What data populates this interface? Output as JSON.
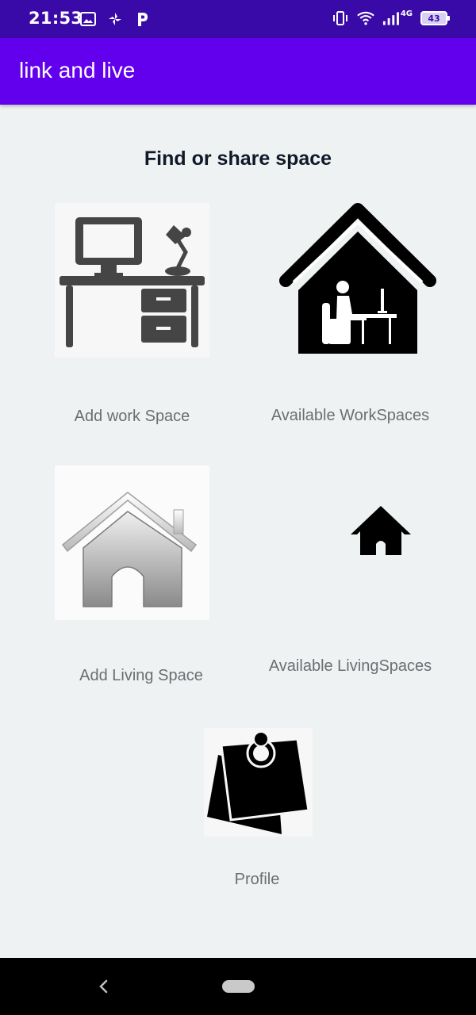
{
  "status_bar": {
    "time": "21:53",
    "left_icons": [
      "gallery-icon",
      "pinwheel-icon",
      "parking-p-icon"
    ],
    "right_icons": [
      "vibrate-icon",
      "wifi-icon",
      "signal-icon",
      "battery-icon"
    ],
    "network_label": "4G",
    "battery_level": "43"
  },
  "app_bar": {
    "title": "link and live"
  },
  "main": {
    "heading": "Find or share space",
    "tiles": [
      {
        "label": "Add work Space",
        "icon": "desk-workspace-icon"
      },
      {
        "label": "Available WorkSpaces",
        "icon": "house-with-worker-icon"
      },
      {
        "label": "Add Living Space",
        "icon": "house-icon"
      },
      {
        "label": "Available LivingSpaces",
        "icon": "small-house-icon"
      },
      {
        "label": "Profile",
        "icon": "pinned-notes-icon"
      }
    ]
  },
  "nav_bar": {
    "icons": [
      "back-icon",
      "home-pill-icon"
    ]
  },
  "colors": {
    "status_bar": "#3a0aa8",
    "app_bar": "#6200ee",
    "background": "#eef2f3",
    "label": "#6b6f72"
  }
}
